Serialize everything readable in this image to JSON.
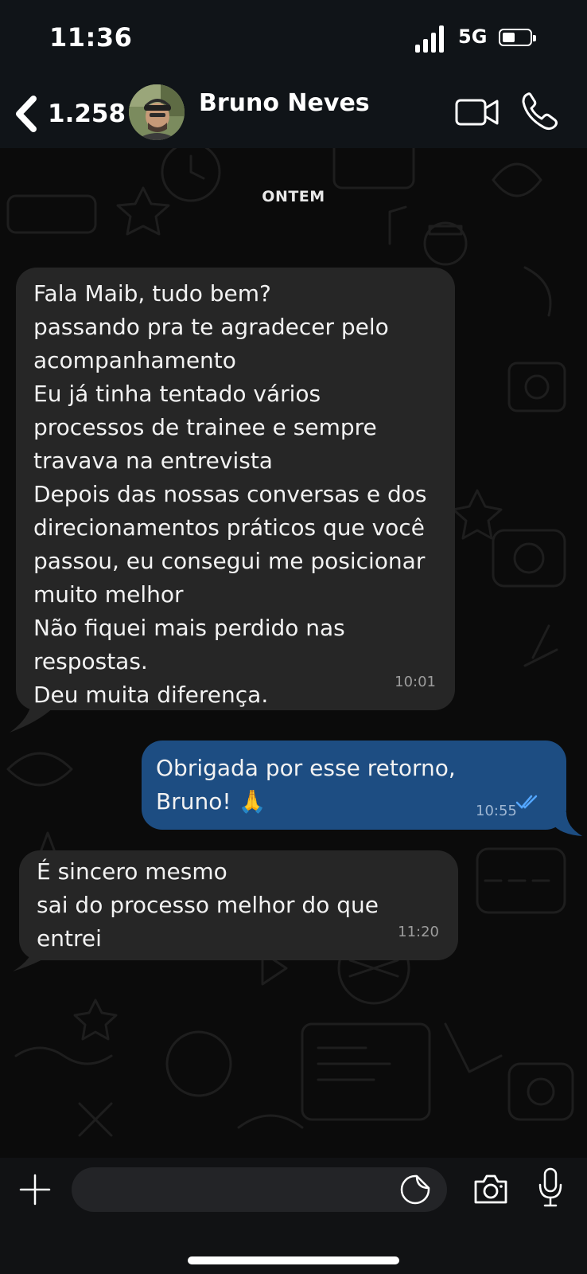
{
  "status_bar": {
    "time": "11:36",
    "network": "5G",
    "battery_level": 0.45
  },
  "header": {
    "back_count": "1.258",
    "contact_name": "Bruno Neves"
  },
  "chat": {
    "date_label": "ONTEM",
    "messages": [
      {
        "direction": "incoming",
        "text": "Fala Maib, tudo bem?\npassando pra te agradecer pelo acompanhamento\nEu já tinha tentado vários processos de trainee e sempre travava na entrevista\nDepois das nossas conversas e dos direcionamentos práticos que você passou, eu consegui me posicionar muito melhor\nNão fiquei mais perdido nas respostas.\nDeu muita diferença.",
        "time": "10:01"
      },
      {
        "direction": "outgoing",
        "text": "Obrigada por esse retorno,\nBruno! 🙏",
        "time": "10:55",
        "status": "read"
      },
      {
        "direction": "incoming",
        "text": "É sincero mesmo\nsai do processo melhor do que entrei",
        "time": "11:20"
      }
    ]
  },
  "composer": {
    "placeholder": ""
  },
  "colors": {
    "header_bg": "#101418",
    "chat_bg": "#0b0b0b",
    "incoming_bubble": "#262626",
    "outgoing_bubble": "#1d4d82",
    "read_ticks": "#53a6ff"
  }
}
